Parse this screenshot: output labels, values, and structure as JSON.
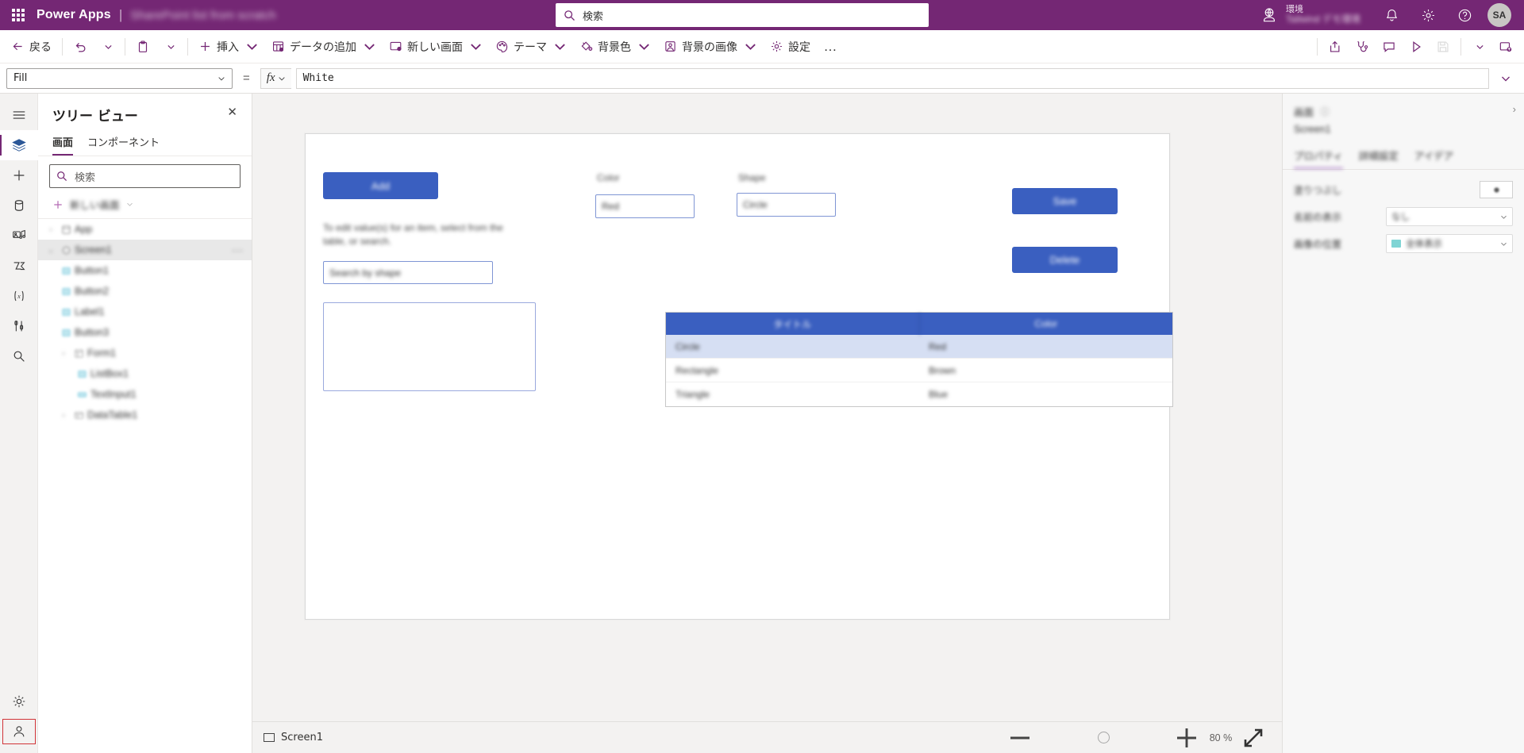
{
  "topbar": {
    "waffle_name": "app-launcher",
    "brand": "Power Apps",
    "separator": "|",
    "app_title": "SharePoint list from scratch",
    "search_placeholder": "検索",
    "environment_label": "環境",
    "environment_name": "Tailwind デモ環境",
    "avatar_initials": "SA"
  },
  "commandbar": {
    "back": "戻る",
    "undo": "元に戻す",
    "redo": "やり直し",
    "paste": "貼り付け",
    "insert": "挿入",
    "add_data": "データの追加",
    "new_screen": "新しい画面",
    "theme": "テーマ",
    "background_color": "背景色",
    "background_image": "背景の画像",
    "settings": "設定",
    "overflow": "…",
    "share": "共有",
    "app_checker": "アプリ チェッカー",
    "comments": "コメント",
    "preview": "プレビュー",
    "save": "保存",
    "more": "その他",
    "publish": "公開"
  },
  "formulabar": {
    "property": "Fill",
    "equals": "=",
    "fx": "fx",
    "formula": "White"
  },
  "rail": {
    "items": [
      {
        "name": "hamburger-menu",
        "label": "メニュー"
      },
      {
        "name": "tree-view",
        "label": "ツリー ビュー",
        "active": true
      },
      {
        "name": "insert",
        "label": "挿入"
      },
      {
        "name": "data",
        "label": "データ"
      },
      {
        "name": "media",
        "label": "メディア"
      },
      {
        "name": "power-automate",
        "label": "Power Automate"
      },
      {
        "name": "variables",
        "label": "変数"
      },
      {
        "name": "tools",
        "label": "ツール"
      },
      {
        "name": "search",
        "label": "検索"
      }
    ],
    "bottom": [
      {
        "name": "settings",
        "label": "設定"
      },
      {
        "name": "account",
        "label": "アカウント"
      }
    ]
  },
  "treeview": {
    "title": "ツリー ビュー",
    "close": "✕",
    "tabs": [
      {
        "label": "画面",
        "active": true
      },
      {
        "label": "コンポーネント",
        "active": false
      }
    ],
    "search_placeholder": "検索",
    "new_screen_label": "新しい画面",
    "items": [
      {
        "label": "App",
        "depth": 0,
        "icon": "app-icon",
        "twisty": "›",
        "selected": false
      },
      {
        "label": "Screen1",
        "depth": 0,
        "icon": "screen-icon",
        "twisty": "⌄",
        "selected": true,
        "overflow": "···"
      },
      {
        "label": "Button1",
        "depth": 1,
        "icon": "control-icon",
        "twisty": "",
        "selected": false
      },
      {
        "label": "Button2",
        "depth": 1,
        "icon": "control-icon",
        "twisty": "",
        "selected": false
      },
      {
        "label": "Label1",
        "depth": 1,
        "icon": "control-icon",
        "twisty": "",
        "selected": false
      },
      {
        "label": "Button3",
        "depth": 1,
        "icon": "control-icon",
        "twisty": "",
        "selected": false
      },
      {
        "label": "Form1",
        "depth": 1,
        "icon": "form-icon",
        "twisty": "›",
        "selected": false
      },
      {
        "label": "ListBox1",
        "depth": 2,
        "icon": "control-icon",
        "twisty": "",
        "selected": false
      },
      {
        "label": "TextInput1",
        "depth": 2,
        "icon": "control-icon",
        "twisty": "",
        "selected": false
      },
      {
        "label": "DataTable1",
        "depth": 1,
        "icon": "table-icon",
        "twisty": "›",
        "selected": false
      }
    ]
  },
  "canvas": {
    "add_button": "Add",
    "helper_text": "To edit value(s) for an item, select from the table, or search.",
    "search_input_value": "Search by shape",
    "color_label": "Color",
    "color_value": "Red",
    "shape_label": "Shape",
    "shape_value": "Circle",
    "save_button": "Save",
    "delete_button": "Delete",
    "table": {
      "headers": [
        "タイトル",
        "Color"
      ],
      "rows": [
        {
          "cells": [
            "Circle",
            "Red"
          ],
          "selected": true
        },
        {
          "cells": [
            "Rectangle",
            "Brown"
          ],
          "selected": false
        },
        {
          "cells": [
            "Triangle",
            "Blue"
          ],
          "selected": false
        }
      ]
    }
  },
  "statusbar": {
    "screen_name": "Screen1",
    "zoom_out": "−",
    "zoom_in": "+",
    "zoom_value": "80",
    "zoom_unit": "%",
    "fit_label": "画面に合わせる"
  },
  "properties": {
    "header": "画面",
    "info_icon": "ⓘ",
    "collapse": "›",
    "subject": "Screen1",
    "tabs": [
      {
        "label": "プロパティ",
        "active": true
      },
      {
        "label": "詳細設定",
        "active": false
      },
      {
        "label": "アイデア",
        "active": false
      }
    ],
    "rows": [
      {
        "key": "塗りつぶし",
        "type": "swatch",
        "value": ""
      },
      {
        "key": "名前の表示",
        "type": "dropdown",
        "value": "なし"
      },
      {
        "key": "画像の位置",
        "type": "dropdown-color",
        "value": "全体表示"
      }
    ]
  },
  "colors": {
    "brand_purple": "#742774",
    "accent_blue": "#3a5fc0",
    "selected_row": "#d6dff3"
  }
}
